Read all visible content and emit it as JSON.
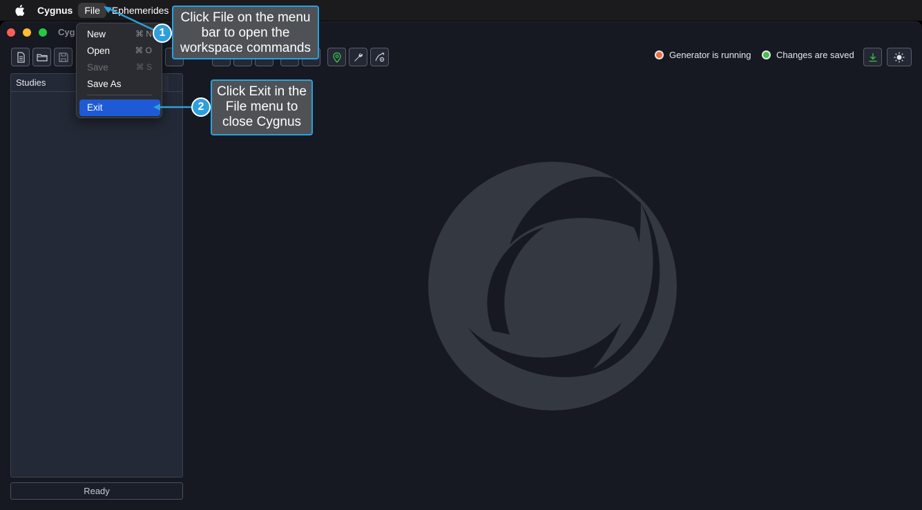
{
  "menubar": {
    "app_name": "Cygnus",
    "items": [
      {
        "label": "File",
        "active": true
      },
      {
        "label": "Ephemerides",
        "active": false
      }
    ]
  },
  "window": {
    "title": "Cyg"
  },
  "toolbar": {
    "buttons": [
      "new-file-icon",
      "open-folder-icon",
      "save-icon",
      "location-pin-icon",
      "wrench-icon",
      "chart-settings-icon",
      "download-icon",
      "sun-icon"
    ]
  },
  "status": {
    "generator": "Generator is running",
    "saved": "Changes are saved"
  },
  "sidebar": {
    "header": "Studies"
  },
  "footer": {
    "ready": "Ready"
  },
  "file_menu": {
    "items": [
      {
        "label": "New",
        "shortcut": "⌘ N",
        "disabled": false
      },
      {
        "label": "Open",
        "shortcut": "⌘ O",
        "disabled": false
      },
      {
        "label": "Save",
        "shortcut": "⌘ S",
        "disabled": true
      },
      {
        "label": "Save As",
        "shortcut": "",
        "disabled": false
      },
      {
        "label": "Exit",
        "shortcut": "",
        "disabled": false,
        "highlighted": true
      }
    ]
  },
  "annotations": [
    {
      "number": "1",
      "text": "Click File on the menu bar to open the workspace commands"
    },
    {
      "number": "2",
      "text": "Click Exit in the File menu to close Cygnus"
    }
  ],
  "colors": {
    "accent": "#2e9fdc",
    "highlight": "#1f5ad6",
    "status_orange": "#f26c3c",
    "status_green": "#3fc34a"
  }
}
